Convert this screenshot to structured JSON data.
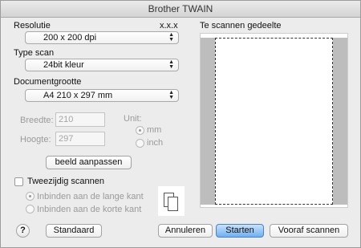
{
  "window": {
    "title": "Brother TWAIN"
  },
  "resolution": {
    "label": "Resolutie",
    "value": "200 x 200 dpi"
  },
  "version": "x.x.x",
  "scan_type": {
    "label": "Type scan",
    "value": "24bit kleur"
  },
  "document_size": {
    "label": "Documentgrootte",
    "value": "A4  210 x 297 mm"
  },
  "width": {
    "label": "Breedte:",
    "value": "210"
  },
  "height": {
    "label": "Hoogte:",
    "value": "297"
  },
  "unit": {
    "label": "Unit:",
    "mm": "mm",
    "inch": "inch",
    "selected": "mm"
  },
  "adjust_button": "beeld aanpassen",
  "duplex": {
    "label": "Tweezijdig scannen",
    "checked": false,
    "long_edge": "Inbinden aan de lange kant",
    "short_edge": "Inbinden aan de korte kant",
    "selected": "long_edge"
  },
  "preview": {
    "label": "Te scannen gedeelte"
  },
  "buttons": {
    "help": "?",
    "default": "Standaard",
    "cancel": "Annuleren",
    "start": "Starten",
    "prescan": "Vooraf scannen"
  },
  "icons": {
    "duplex": "duplex-pages-icon",
    "select_arrows": "updown-arrows-icon"
  }
}
